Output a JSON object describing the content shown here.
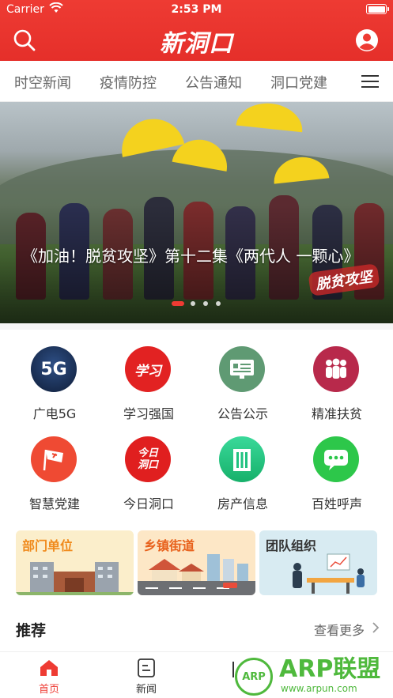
{
  "status_bar": {
    "carrier": "Carrier",
    "time": "2:53 PM"
  },
  "header": {
    "logo_text": "新洞口",
    "brand_color": "#ee3b33"
  },
  "tabs": [
    "时空新闻",
    "疫情防控",
    "公告通知",
    "洞口党建"
  ],
  "banner": {
    "caption": "《加油！脱贫攻坚》第十二集《两代人 一颗心》",
    "badge_text": "脱贫攻坚",
    "page_count": 4,
    "active_page": 1
  },
  "grid": [
    {
      "label": "广电5G",
      "icon": "5g-icon",
      "icon_text": "5G",
      "color": "#1a2f55"
    },
    {
      "label": "学习强国",
      "icon": "xuexi-icon",
      "icon_text": "学习",
      "color": "#e22222"
    },
    {
      "label": "公告公示",
      "icon": "notice-board-icon",
      "icon_text": "",
      "color": "#5f9a73"
    },
    {
      "label": "精准扶贫",
      "icon": "people-icon",
      "icon_text": "",
      "color": "#b8294b"
    },
    {
      "label": "智慧党建",
      "icon": "party-flag-icon",
      "icon_text": "",
      "color": "#ef4a33"
    },
    {
      "label": "今日洞口",
      "icon": "today-dongkou-icon",
      "icon_text": "今日洞口",
      "color": "#e01f1f"
    },
    {
      "label": "房产信息",
      "icon": "building-icon",
      "icon_text": "",
      "color": "#1fc27f"
    },
    {
      "label": "百姓呼声",
      "icon": "chat-icon",
      "icon_text": "···",
      "color": "#2dc74a"
    }
  ],
  "categories": [
    {
      "label": "部门单位",
      "bg": "#fbeecb",
      "color": "#f08a1c"
    },
    {
      "label": "乡镇街道",
      "bg": "#fde7c6",
      "color": "#e8611c"
    },
    {
      "label": "团队组织",
      "bg": "#d8ebf2",
      "color": "#333333"
    }
  ],
  "recommend": {
    "title": "推荐",
    "more": "查看更多"
  },
  "bottom_nav": [
    {
      "label": "首页",
      "icon": "home-icon",
      "active": true
    },
    {
      "label": "新闻",
      "icon": "news-icon",
      "active": false
    }
  ],
  "watermark": {
    "circle_text": "ARP",
    "brand": "ARP联盟",
    "url": "www.arpun.com"
  }
}
